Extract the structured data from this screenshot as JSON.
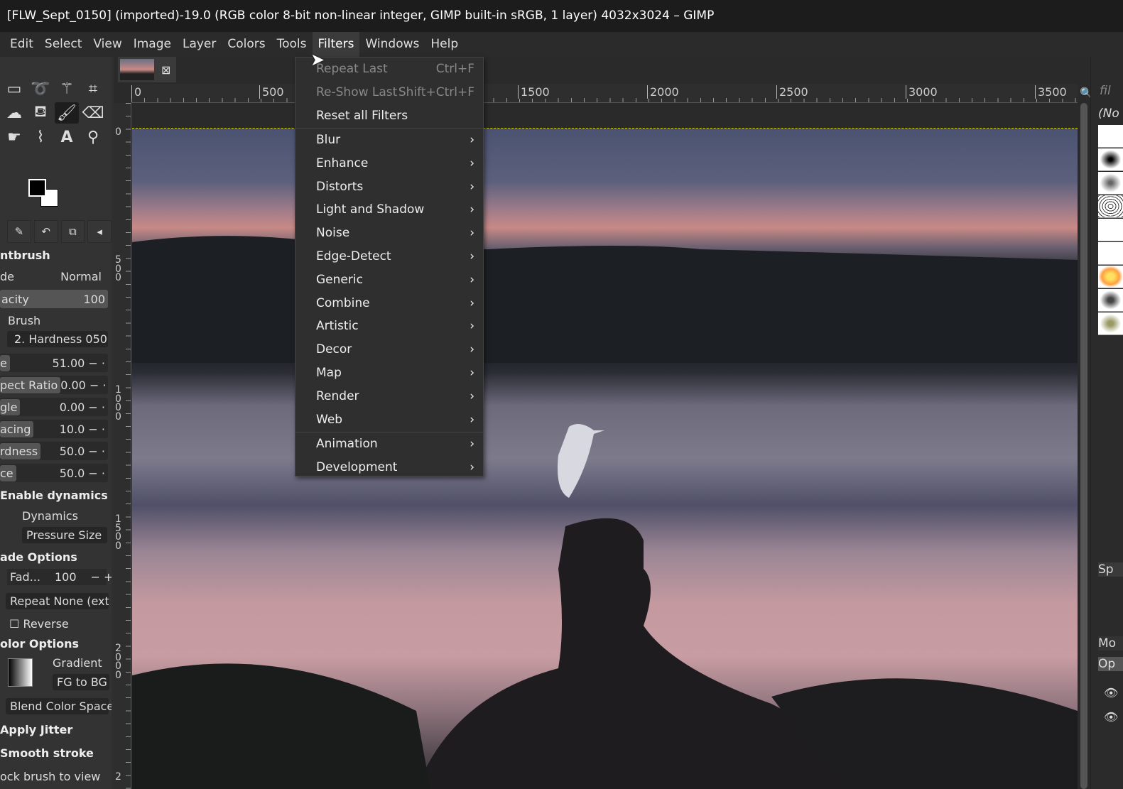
{
  "title": "[FLW_Sept_0150] (imported)-19.0 (RGB color 8-bit non-linear integer, GIMP built-in sRGB, 1 layer) 4032x3024 – GIMP",
  "menubar": [
    "Edit",
    "Select",
    "View",
    "Image",
    "Layer",
    "Colors",
    "Tools",
    "Filters",
    "Windows",
    "Help"
  ],
  "filters_menu": {
    "top": [
      {
        "label": "Repeat Last",
        "shortcut": "Ctrl+F"
      },
      {
        "label": "Re-Show Last",
        "shortcut": "Shift+Ctrl+F"
      },
      {
        "label": "Reset all Filters"
      }
    ],
    "submenus": [
      "Blur",
      "Enhance",
      "Distorts",
      "Light and Shadow",
      "Noise",
      "Edge-Detect",
      "Generic",
      "Combine",
      "Artistic",
      "Decor",
      "Map",
      "Render",
      "Web"
    ],
    "bottom": [
      "Animation",
      "Development"
    ]
  },
  "hruler": [
    "0",
    "500",
    "1500",
    "2000",
    "2500",
    "3000",
    "3500"
  ],
  "vruler": [
    "0",
    "5\n0\n0",
    "1\n0\n0\n0",
    "1\n5\n0\n0",
    "2\n0\n0\n0",
    "2"
  ],
  "tool_options": {
    "title": "ntbrush",
    "mode_label": "de",
    "mode_value": "Normal",
    "opacity_label": "acity",
    "opacity_value": "100",
    "brush_label": "Brush",
    "brush_value": "2. Hardness 050",
    "sliders": [
      {
        "label": "e",
        "value": "51.00"
      },
      {
        "label": "pect Ratio",
        "value": "0.00"
      },
      {
        "label": "gle",
        "value": "0.00"
      },
      {
        "label": "acing",
        "value": "10.0"
      },
      {
        "label": "rdness",
        "value": "50.0"
      },
      {
        "label": "ce",
        "value": "50.0"
      }
    ],
    "enable_dynamics": "Enable dynamics",
    "dynamics_label": "Dynamics",
    "dynamics_value": "Pressure Size",
    "fade_options": "ade Options",
    "fade_label": "Fad...",
    "fade_value": "100",
    "repeat_label": "Repeat",
    "repeat_value": "None (ext",
    "reverse": "Reverse",
    "color_options": "olor Options",
    "gradient_label": "Gradient",
    "gradient_value": "FG to BG",
    "blend": "Blend Color Space",
    "apply_jitter": "Apply Jitter",
    "smooth_stroke": "Smooth stroke",
    "lock_brush": "ock brush to view"
  },
  "dock": {
    "filter": "fil",
    "none": "(No",
    "sp": "Sp",
    "mode": "Mo",
    "op": "Op"
  }
}
